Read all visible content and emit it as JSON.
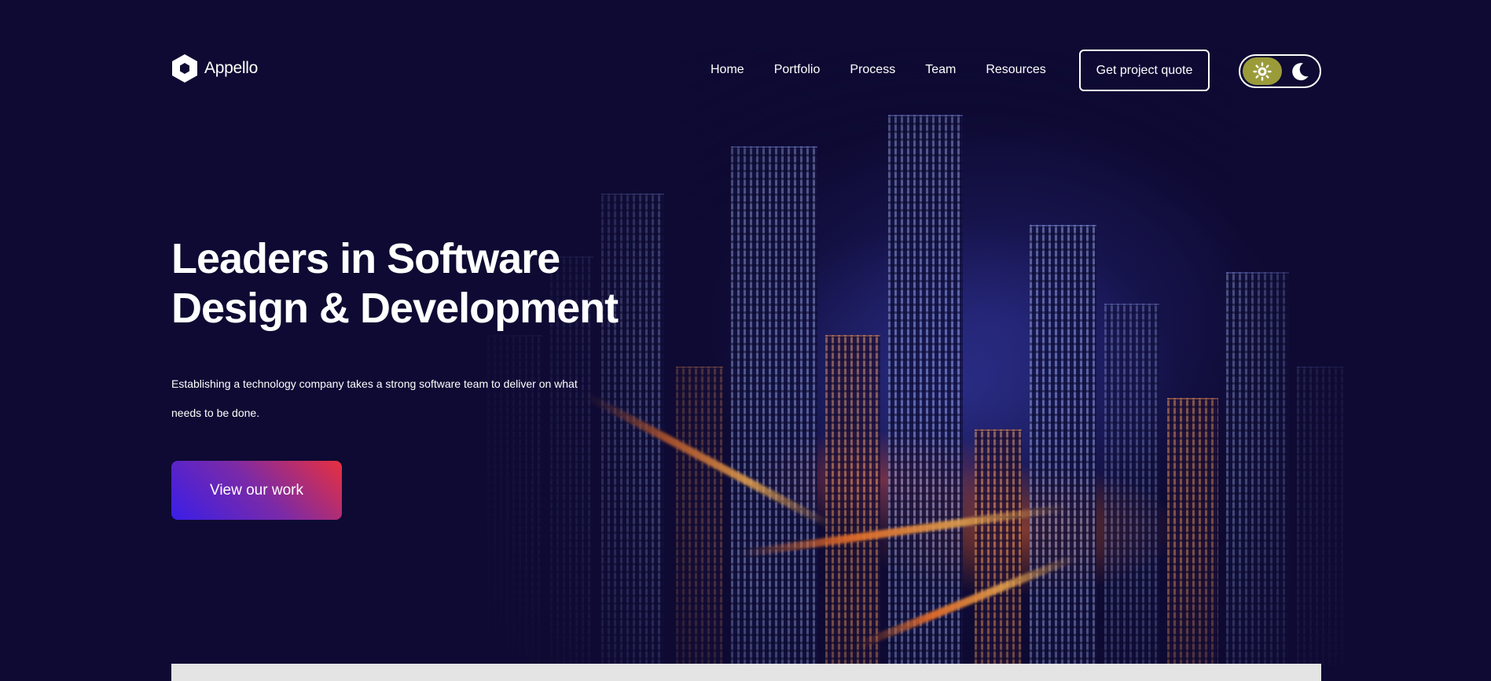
{
  "brand": {
    "name": "Appello",
    "icon": "hexagon-logo-icon"
  },
  "nav": {
    "items": [
      {
        "label": "Home"
      },
      {
        "label": "Portfolio"
      },
      {
        "label": "Process"
      },
      {
        "label": "Team"
      },
      {
        "label": "Resources"
      }
    ],
    "quote_button": "Get project quote",
    "theme_toggle": {
      "light_icon": "sun-icon",
      "dark_icon": "moon-icon",
      "active": "light"
    }
  },
  "hero": {
    "title_line1": "Leaders in Software",
    "title_line2": "Design & Development",
    "description": "Establishing a technology company takes a strong software team to deliver on what needs to be done.",
    "cta_label": "View our work",
    "background": "city-night-image"
  },
  "colors": {
    "background": "#0e0a33",
    "toggle_active": "#9b9b3a",
    "cta_gradient_start": "#3a1ee8",
    "cta_gradient_end": "#e8303e",
    "panel": "#e4e4e4"
  }
}
